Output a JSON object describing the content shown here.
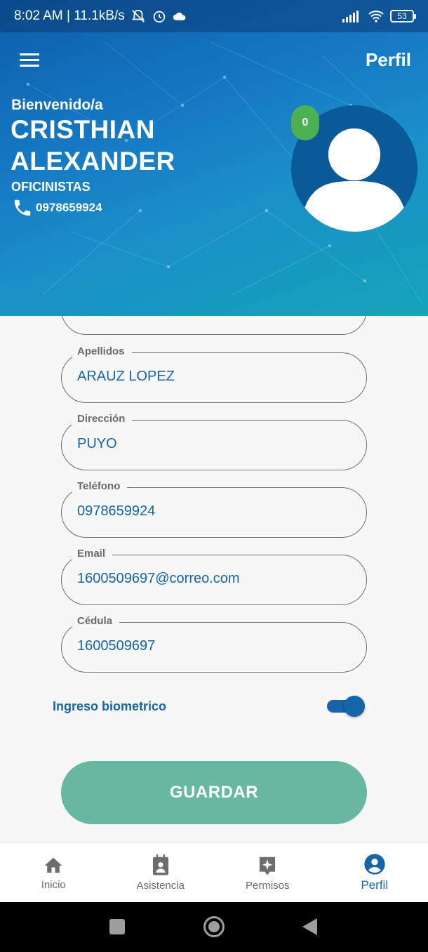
{
  "status_bar": {
    "time": "8:02 AM | 11.1kB/s",
    "battery": "53"
  },
  "header": {
    "title": "Perfil",
    "welcome": "Bienvenido/a",
    "first_name": "CRISTHIAN",
    "second_name": "ALEXANDER",
    "role": "OFICINISTAS",
    "phone": "0978659924",
    "badge_count": "0"
  },
  "form": {
    "fields": [
      {
        "label": "Apellidos",
        "value": "ARAUZ LOPEZ"
      },
      {
        "label": "Dirección",
        "value": "PUYO"
      },
      {
        "label": "Teléfono",
        "value": "0978659924"
      },
      {
        "label": "Email",
        "value": "1600509697@correo.com"
      },
      {
        "label": "Cédula",
        "value": "1600509697"
      }
    ],
    "biometric_label": "Ingreso biometrico",
    "biometric_enabled": true,
    "save_label": "GUARDAR"
  },
  "bottom_nav": {
    "items": [
      {
        "label": "Inicio",
        "icon": "home-icon"
      },
      {
        "label": "Asistencia",
        "icon": "attendance-icon"
      },
      {
        "label": "Permisos",
        "icon": "permissions-icon"
      },
      {
        "label": "Perfil",
        "icon": "profile-icon",
        "active": true
      }
    ]
  },
  "colors": {
    "primary": "#1565a8",
    "accent_green": "#4caf50",
    "button": "#66b8a0"
  }
}
